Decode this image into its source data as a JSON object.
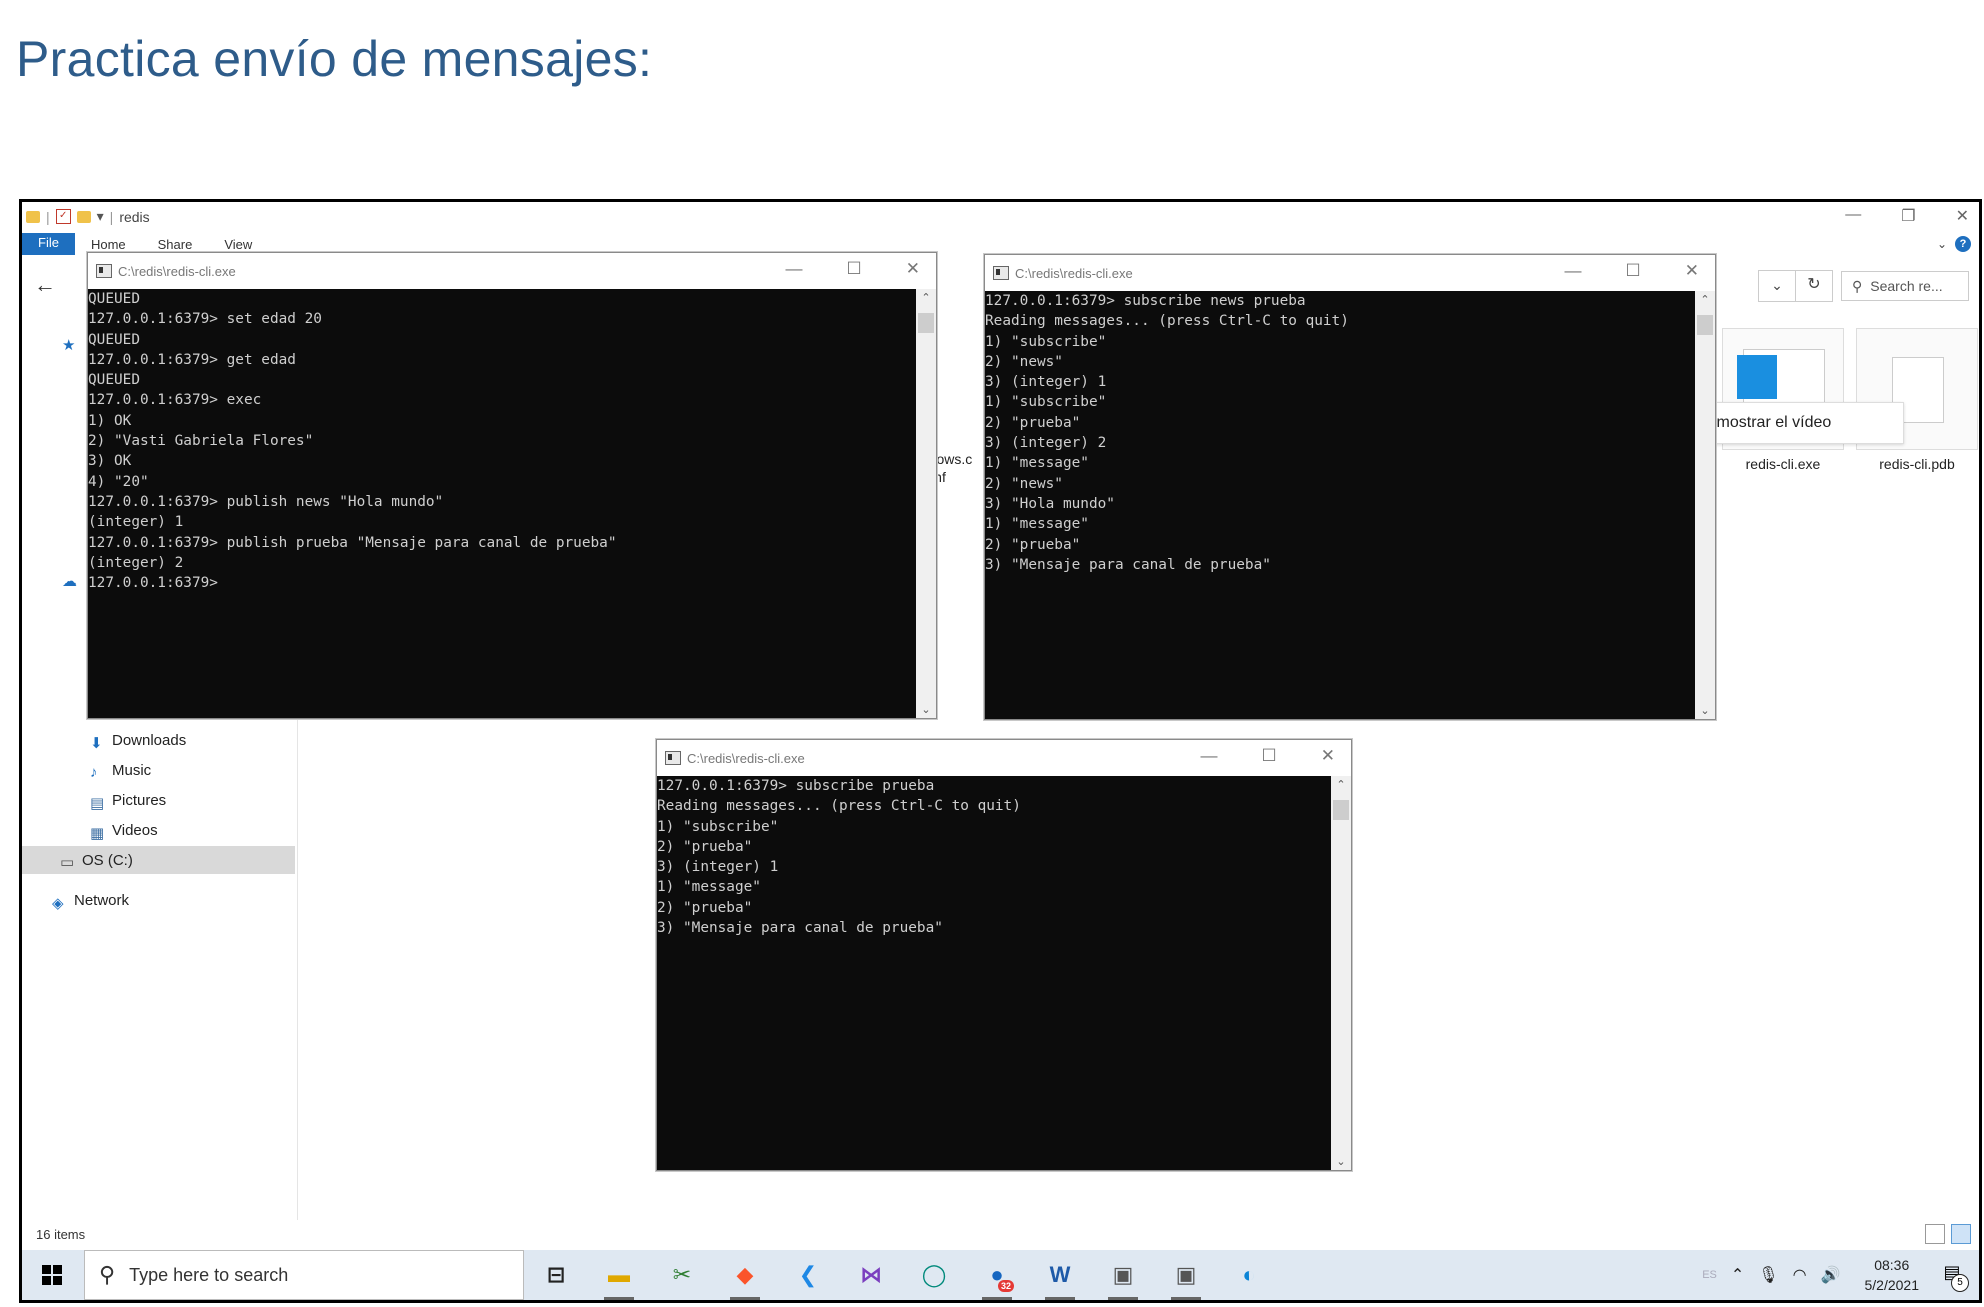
{
  "slide": {
    "title": "Practica envío de mensajes:"
  },
  "explorer": {
    "title": "redis",
    "qa_separator": "|",
    "qa_dropdown": "▾",
    "ribbon_tabs": [
      "File",
      "Home",
      "Share",
      "View"
    ],
    "search_placeholder": "Search re...",
    "nav_items": [
      "Downloads",
      "Music",
      "Pictures",
      "Videos",
      "OS (C:)",
      "Network"
    ],
    "files": [
      {
        "name": "windows.c\nnf",
        "icon": "file-icon"
      },
      {
        "name": "redis-cli.exe",
        "icon": "exe-icon"
      },
      {
        "name": "redis-cli.pdb",
        "icon": "file-icon"
      }
    ],
    "status": "16 items",
    "popup": "Expandir el panel para mostrar el vídeo"
  },
  "consoles": [
    {
      "title": "C:\\redis\\redis-cli.exe",
      "lines": [
        "QUEUED",
        "127.0.0.1:6379> set edad 20",
        "QUEUED",
        "127.0.0.1:6379> get edad",
        "QUEUED",
        "127.0.0.1:6379> exec",
        "1) OK",
        "2) \"Vasti Gabriela Flores\"",
        "3) OK",
        "4) \"20\"",
        "127.0.0.1:6379> publish news \"Hola mundo\"",
        "(integer) 1",
        "127.0.0.1:6379> publish prueba \"Mensaje para canal de prueba\"",
        "(integer) 2",
        "127.0.0.1:6379>"
      ]
    },
    {
      "title": "C:\\redis\\redis-cli.exe",
      "lines": [
        "127.0.0.1:6379> subscribe news prueba",
        "Reading messages... (press Ctrl-C to quit)",
        "1) \"subscribe\"",
        "2) \"news\"",
        "3) (integer) 1",
        "1) \"subscribe\"",
        "2) \"prueba\"",
        "3) (integer) 2",
        "1) \"message\"",
        "2) \"news\"",
        "3) \"Hola mundo\"",
        "1) \"message\"",
        "2) \"prueba\"",
        "3) \"Mensaje para canal de prueba\""
      ]
    },
    {
      "title": "C:\\redis\\redis-cli.exe",
      "lines": [
        "127.0.0.1:6379> subscribe prueba",
        "Reading messages... (press Ctrl-C to quit)",
        "1) \"subscribe\"",
        "2) \"prueba\"",
        "3) (integer) 1",
        "1) \"message\"",
        "2) \"prueba\"",
        "3) \"Mensaje para canal de prueba\""
      ]
    }
  ],
  "taskbar": {
    "search_placeholder": "Type here to search",
    "mail_badge": "32",
    "time": "08:36",
    "date": "5/2/2021",
    "notification_count": "5",
    "lang": "ES"
  },
  "colors": {
    "title": "#2E5C8A",
    "console_bg": "#0c0c0c",
    "console_fg": "#cfcfcf",
    "taskbar": "#dfe8f2",
    "accent": "#1e6fbf"
  }
}
